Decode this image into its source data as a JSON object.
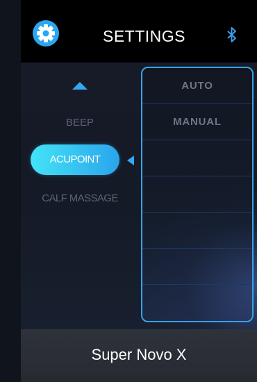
{
  "header": {
    "title": "SETTINGS",
    "settings_icon": "gear-icon",
    "bluetooth_icon": "bluetooth-icon"
  },
  "menu": {
    "up_icon": "triangle-up-icon",
    "items": [
      "BEEP",
      "ACUPOINT",
      "CALF MASSAGE"
    ],
    "selected": "ACUPOINT"
  },
  "options": {
    "items": [
      "AUTO",
      "MANUAL",
      "",
      "",
      "",
      "",
      ""
    ]
  },
  "footer": {
    "model": "Super Novo X"
  },
  "colors": {
    "accent": "#36a8f0",
    "pill_start": "#43e3f7",
    "pill_end": "#2aa5ec"
  }
}
